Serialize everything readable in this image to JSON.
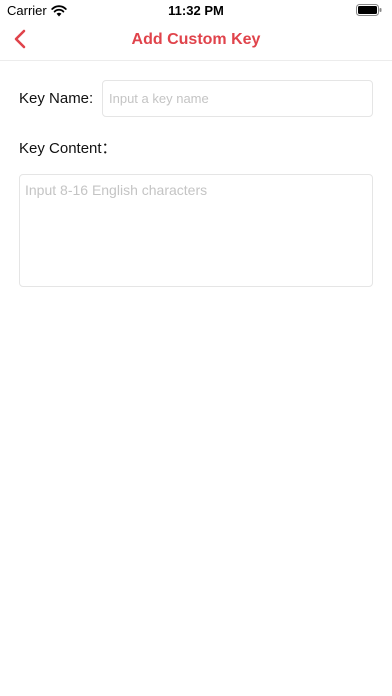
{
  "status_bar": {
    "carrier": "Carrier",
    "time": "11:32 PM"
  },
  "nav": {
    "title": "Add Custom Key",
    "back_icon": "chevron-left-icon",
    "accent_color": "#e0434b"
  },
  "form": {
    "key_name": {
      "label": "Key Name:",
      "value": "",
      "placeholder": "Input a key name"
    },
    "key_content": {
      "label": "Key Content：",
      "value": "",
      "placeholder": "Input 8-16 English characters"
    }
  }
}
